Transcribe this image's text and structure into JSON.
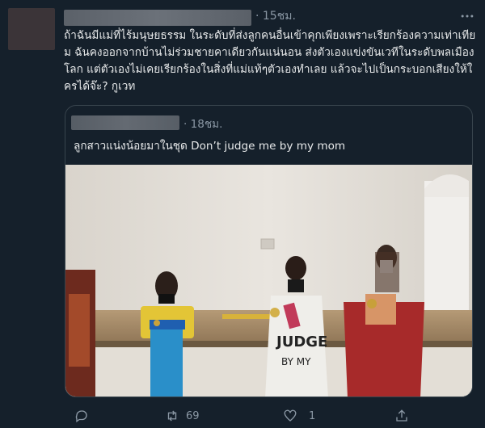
{
  "tweet": {
    "time": "· 15ชม.",
    "body": "ถ้าฉันมีแม่ที่ไร้มนุษยธรรม ในระดับที่ส่งลูกคนอื่นเข้าคุกเพียงเพราะเรียกร้องความเท่าเทียม ฉันคงออกจากบ้านไม่ร่วมชายคาเดียวกันแน่นอน ส่งตัวเองแข่งขันเวทีในระดับพลเมืองโลก แต่ตัวเองไม่เคยเรียกร้องในสิ่งที่แม่แท้ๆตัวเองทำเลย แล้วจะไปเป็นกระบอกเสียงให้ใครได้จ๊ะ? กูเวท",
    "more_icon": "more-options-icon"
  },
  "quote": {
    "time": "· 18ชม.",
    "text": "ลูกสาวแน่งน้อยมาในชุด Don’t judge me by my mom"
  },
  "actions": {
    "reply_icon": "reply-icon",
    "retweet_icon": "retweet-icon",
    "retweet_count": "69",
    "like_icon": "heart-icon",
    "like_count": "1",
    "share_icon": "share-icon"
  }
}
